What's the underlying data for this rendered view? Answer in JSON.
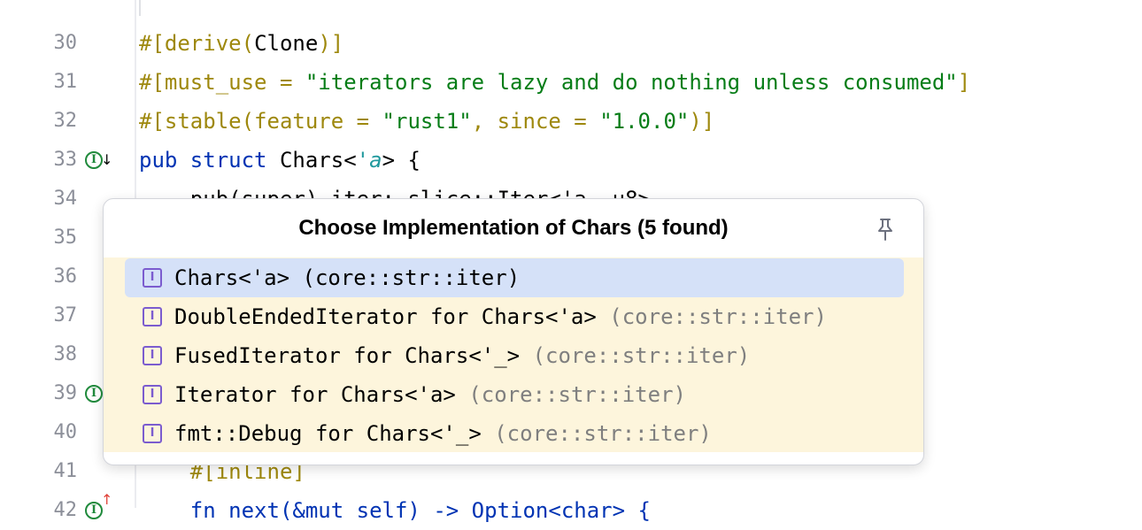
{
  "editor": {
    "lines": [
      {
        "num": "30",
        "tokens": [
          {
            "t": "#[",
            "c": "t-attr"
          },
          {
            "t": "derive",
            "c": "t-attr"
          },
          {
            "t": "(",
            "c": "t-attr"
          },
          {
            "t": "Clone",
            "c": "t-type"
          },
          {
            "t": ")]",
            "c": "t-attr"
          }
        ]
      },
      {
        "num": "31",
        "tokens": [
          {
            "t": "#[must_use = ",
            "c": "t-attr"
          },
          {
            "t": "\"iterators are lazy and do nothing unless consumed\"",
            "c": "t-str"
          },
          {
            "t": "]",
            "c": "t-attr"
          }
        ]
      },
      {
        "num": "32",
        "tokens": [
          {
            "t": "#[stable(feature = ",
            "c": "t-attr"
          },
          {
            "t": "\"rust1\"",
            "c": "t-str"
          },
          {
            "t": ", since = ",
            "c": "t-attr"
          },
          {
            "t": "\"1.0.0\"",
            "c": "t-str"
          },
          {
            "t": ")]",
            "c": "t-attr"
          }
        ]
      },
      {
        "num": "33",
        "gutter": "implemented-down",
        "tokens": [
          {
            "t": "pub ",
            "c": "t-kw"
          },
          {
            "t": "struct ",
            "c": "t-kw"
          },
          {
            "t": "Chars<",
            "c": "t-type"
          },
          {
            "t": "'a",
            "c": "t-life"
          },
          {
            "t": "> {",
            "c": "t-type"
          }
        ]
      },
      {
        "num": "34",
        "tokens": [
          {
            "t": "    pub(super) iter: slice::Iter<'a, u8>,",
            "c": "t-type"
          }
        ]
      },
      {
        "num": "35",
        "tokens": []
      },
      {
        "num": "36",
        "tokens": []
      },
      {
        "num": "37",
        "tokens": []
      },
      {
        "num": "38",
        "tokens": []
      },
      {
        "num": "39",
        "gutter": "implementing-up",
        "tokens": []
      },
      {
        "num": "40",
        "tokens": []
      },
      {
        "num": "41",
        "tokens": [
          {
            "t": "    #[inline]",
            "c": "t-attr"
          }
        ]
      },
      {
        "num": "42",
        "gutter": "implementing-up",
        "tokens": [
          {
            "t": "    fn next(&mut self) -> Option<char> {",
            "c": "t-kw"
          }
        ]
      }
    ]
  },
  "popup": {
    "title": "Choose Implementation of Chars (5 found)",
    "pin_icon": "pin-icon",
    "items": [
      {
        "name": "Chars<'a> ",
        "location": "(core::str::iter)",
        "selected": true
      },
      {
        "name": "DoubleEndedIterator for Chars<'a> ",
        "location": "(core::str::iter)",
        "selected": false
      },
      {
        "name": "FusedIterator for Chars<'_> ",
        "location": "(core::str::iter)",
        "selected": false
      },
      {
        "name": "Iterator for Chars<'a> ",
        "location": "(core::str::iter)",
        "selected": false
      },
      {
        "name": "fmt::Debug for Chars<'_> ",
        "location": "(core::str::iter)",
        "selected": false
      }
    ]
  },
  "colors": {
    "attribute": "#9e880d",
    "string": "#067d17",
    "keyword": "#0033b3",
    "lifetime": "#20999d",
    "list_background": "#fdf5dc",
    "selection": "#d5e1f8",
    "impl_icon": "#7b5ccf",
    "gutter_icon": "#208a3c"
  }
}
